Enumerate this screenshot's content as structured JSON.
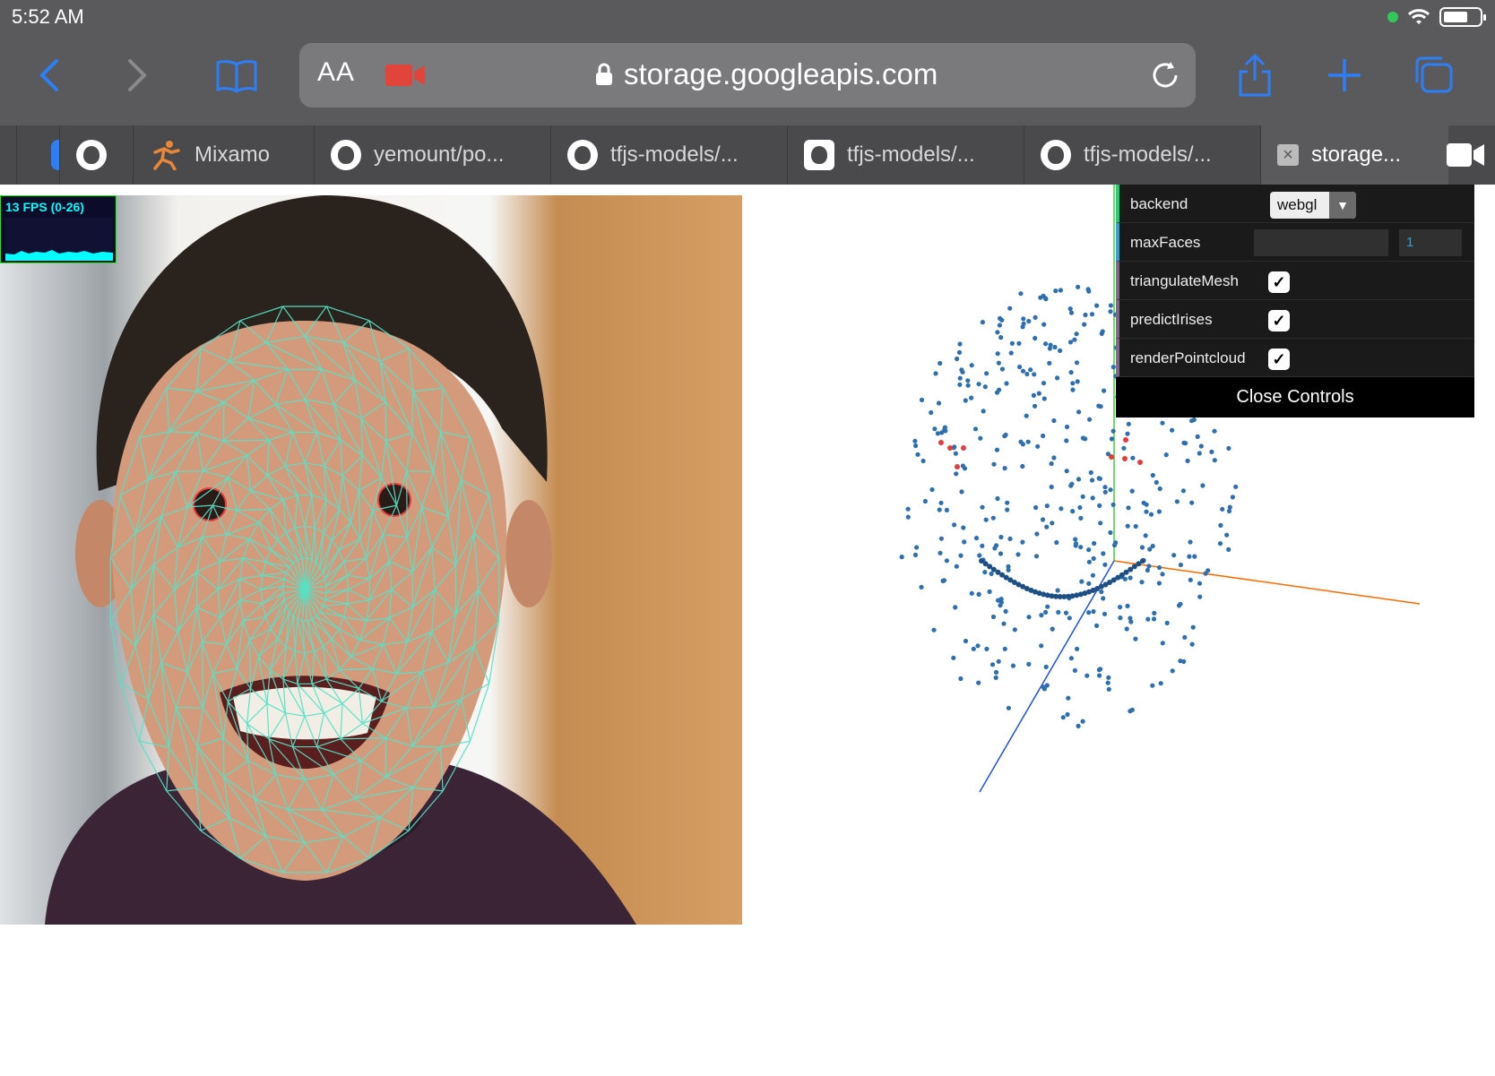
{
  "status": {
    "time": "5:52 AM"
  },
  "address_bar": {
    "text_size_label": "AA",
    "url": "storage.googleapis.com"
  },
  "tabs": [
    {
      "label": "Mixamo",
      "icon": "mixamo-icon"
    },
    {
      "label": "yemount/po...",
      "icon": "github-icon"
    },
    {
      "label": "tfjs-models/...",
      "icon": "github-icon"
    },
    {
      "label": "tfjs-models/...",
      "icon": "github-icon"
    },
    {
      "label": "tfjs-models/...",
      "icon": "github-icon"
    },
    {
      "label": "storage...",
      "icon": "close-icon"
    }
  ],
  "stats": {
    "fps_label": "13 FPS (0-26)"
  },
  "controls": {
    "backend_label": "backend",
    "backend_value": "webgl",
    "max_faces_label": "maxFaces",
    "max_faces_value": "1",
    "triangulate_label": "triangulateMesh",
    "predict_irises_label": "predictIrises",
    "render_pointcloud_label": "renderPointcloud",
    "check_glyph": "✓",
    "close_label": "Close Controls"
  },
  "colors": {
    "mesh": "#56e2c7",
    "points": "#2f6fae",
    "iris_points": "#e33c3c",
    "axis_x": "#ff6a00",
    "axis_y": "#40d040",
    "axis_z": "#2050e0",
    "accent": "#2d7ff9",
    "camera_indicator": "#e0443b"
  }
}
